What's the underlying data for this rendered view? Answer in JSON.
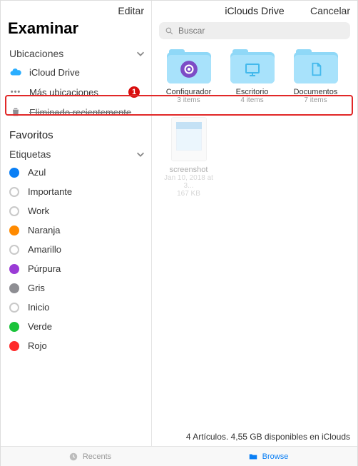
{
  "sidebar": {
    "edit_label": "Editar",
    "title": "Examinar",
    "locations": {
      "header": "Ubicaciones",
      "items": [
        {
          "label": "iCloud Drive"
        },
        {
          "label": "Más ubicaciones",
          "badge": "1"
        },
        {
          "label": "Eliminado recientemente"
        }
      ]
    },
    "favorites_header": "Favoritos",
    "tags_header": "Etiquetas",
    "tags": [
      {
        "label": "Azul",
        "color": "#0a7ff5",
        "filled": true
      },
      {
        "label": "Importante",
        "color": "#c9c9c9",
        "filled": false
      },
      {
        "label": "Work",
        "color": "#c9c9c9",
        "filled": false
      },
      {
        "label": "Naranja",
        "color": "#ff8a00",
        "filled": true
      },
      {
        "label": "Amarillo",
        "color": "#c9c9c9",
        "filled": false
      },
      {
        "label": "Púrpura",
        "color": "#9a3bd6",
        "filled": true
      },
      {
        "label": "Gris",
        "color": "#8e8e93",
        "filled": true
      },
      {
        "label": "Inicio",
        "color": "#c9c9c9",
        "filled": false
      },
      {
        "label": "Verde",
        "color": "#1ac33a",
        "filled": true
      },
      {
        "label": "Rojo",
        "color": "#ff2b2b",
        "filled": true
      }
    ]
  },
  "content": {
    "title": "iClouds Drive",
    "cancel_label": "Cancelar",
    "search_placeholder": "Buscar",
    "folders": [
      {
        "name": "Configurador",
        "meta": "3 items",
        "glyph": "gear"
      },
      {
        "name": "Escritorio",
        "meta": "4 items",
        "glyph": "desktop"
      },
      {
        "name": "Documentos",
        "meta": "7 items",
        "glyph": "doc"
      }
    ],
    "files": [
      {
        "name": "screenshot",
        "date": "Jan 10, 2018 at 3...",
        "size": "167 KB"
      }
    ],
    "status": "4 Artículos. 4,55 GB disponibles en iClouds"
  },
  "tabbar": {
    "recents": "Recents",
    "browse": "Browse"
  }
}
